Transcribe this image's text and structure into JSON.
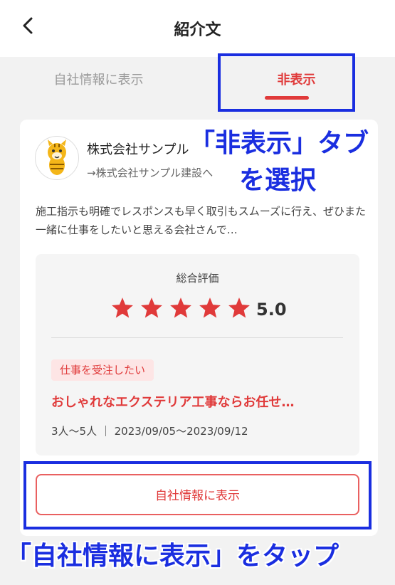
{
  "header": {
    "title": "紹介文"
  },
  "tabs": [
    {
      "label": "自社情報に表示",
      "active": false
    },
    {
      "label": "非表示",
      "active": true
    }
  ],
  "review": {
    "company_name": "株式会社サンプル",
    "company_link": "→株式会社サンプル建設へ",
    "description": "施工指示も明確でレスポンスも早く取引もスムーズに行え、ぜひまた一緒に仕事をしたいと思える会社さんで…",
    "rating_label": "総合評価",
    "rating": 5,
    "score_text": "5.0",
    "tag": "仕事を受注したい",
    "job_title": "おしゃれなエクステリア工事ならお任せ…",
    "meta": "3人〜5人 ｜ 2023/09/05〜2023/09/12",
    "show_button": "自社情報に表示"
  },
  "annotations": {
    "tab_note_line1": "「非表示」タブ",
    "tab_note_line2": "を選択",
    "button_note": "「自社情報に表示」をタップ"
  },
  "colors": {
    "accent": "#e03a3a",
    "annotation": "#1a2ee0",
    "tag_bg": "#fde5e5"
  },
  "icons": {
    "back": "chevron-left-icon",
    "avatar": "tiger-mascot-icon",
    "star": "star-icon"
  }
}
